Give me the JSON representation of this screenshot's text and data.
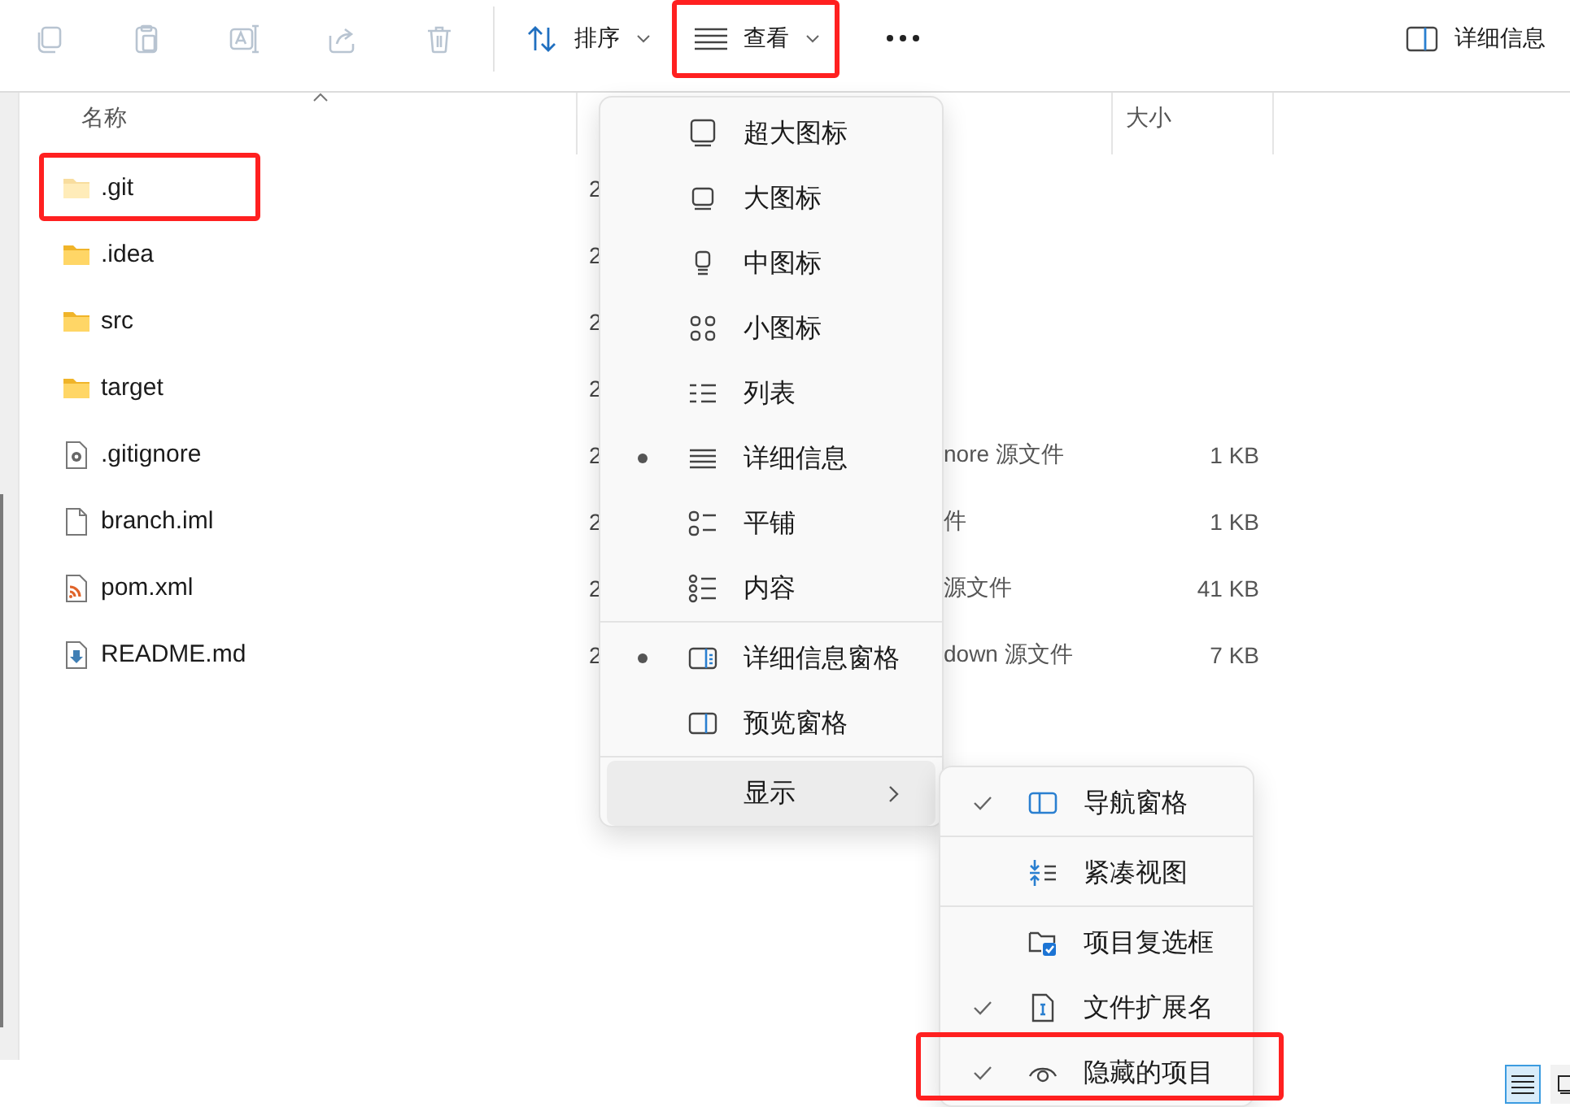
{
  "toolbar": {
    "actions": [
      {
        "kind": "copy",
        "disabled": true
      },
      {
        "kind": "paste",
        "disabled": true
      },
      {
        "kind": "rename",
        "disabled": true
      },
      {
        "kind": "share",
        "disabled": true
      },
      {
        "kind": "delete",
        "disabled": true
      }
    ],
    "sort_button": {
      "label": "排序"
    },
    "view_button": {
      "label": "查看",
      "highlighted": true
    },
    "details_button": {
      "label": "详细信息"
    }
  },
  "table": {
    "header": {
      "name": "名称",
      "size": "大小"
    },
    "rows": [
      {
        "kind": "folder",
        "name": ".git",
        "hidden": true,
        "highlighted": true,
        "column_2": "2"
      },
      {
        "kind": "folder",
        "name": ".idea",
        "hidden": false,
        "highlighted": false,
        "column_2": "2"
      },
      {
        "kind": "folder",
        "name": "src",
        "hidden": false,
        "highlighted": false,
        "column_2": "2"
      },
      {
        "kind": "folder",
        "name": "target",
        "hidden": false,
        "highlighted": false,
        "column_2": "2"
      },
      {
        "kind": "config",
        "name": ".gitignore",
        "hidden": false,
        "highlighted": false,
        "column_2": "2",
        "column_3": "nore 源文件",
        "size": "1 KB"
      },
      {
        "kind": "blank",
        "name": "branch.iml",
        "hidden": false,
        "highlighted": false,
        "column_2": "2",
        "column_3": "件",
        "size": "1 KB"
      },
      {
        "kind": "feed",
        "name": "pom.xml",
        "hidden": false,
        "highlighted": false,
        "column_2": "2",
        "column_3": "源文件",
        "size": "41 KB"
      },
      {
        "kind": "markdown",
        "name": "README.md",
        "hidden": false,
        "highlighted": false,
        "column_2": "2",
        "column_3": "down 源文件",
        "size": "7 KB"
      }
    ]
  },
  "menu": {
    "groups": [
      {
        "items": [
          {
            "kind": "extra-large",
            "label": "超大图标",
            "selected": false
          },
          {
            "kind": "large",
            "label": "大图标",
            "selected": false
          },
          {
            "kind": "medium",
            "label": "中图标",
            "selected": false
          },
          {
            "kind": "small",
            "label": "小图标",
            "selected": false
          },
          {
            "kind": "list",
            "label": "列表",
            "selected": false
          },
          {
            "kind": "details",
            "label": "详细信息",
            "selected": true
          },
          {
            "kind": "tiles",
            "label": "平铺",
            "selected": false
          },
          {
            "kind": "content",
            "label": "内容",
            "selected": false
          }
        ]
      },
      {
        "items": [
          {
            "kind": "details-pane",
            "label": "详细信息窗格",
            "selected": true
          },
          {
            "kind": "preview-pane",
            "label": "预览窗格",
            "selected": false
          }
        ]
      },
      {
        "items": [
          {
            "kind": "submenu",
            "label": "显示",
            "open": true
          }
        ]
      }
    ]
  },
  "submenu": {
    "groups": [
      {
        "items": [
          {
            "kind": "nav-pane",
            "label": "导航窗格",
            "checked": true,
            "highlighted": false
          }
        ]
      },
      {
        "items": [
          {
            "kind": "compact",
            "label": "紧凑视图",
            "checked": false,
            "highlighted": false
          }
        ]
      },
      {
        "items": [
          {
            "kind": "checkboxes",
            "label": "项目复选框",
            "checked": false,
            "highlighted": false
          },
          {
            "kind": "extensions",
            "label": "文件扩展名",
            "checked": true,
            "highlighted": false
          },
          {
            "kind": "hidden",
            "label": "隐藏的项目",
            "checked": true,
            "highlighted": true
          }
        ]
      }
    ]
  },
  "status_bar": {
    "views": [
      {
        "kind": "details",
        "selected": true
      },
      {
        "kind": "large-icons",
        "selected": false
      }
    ]
  }
}
